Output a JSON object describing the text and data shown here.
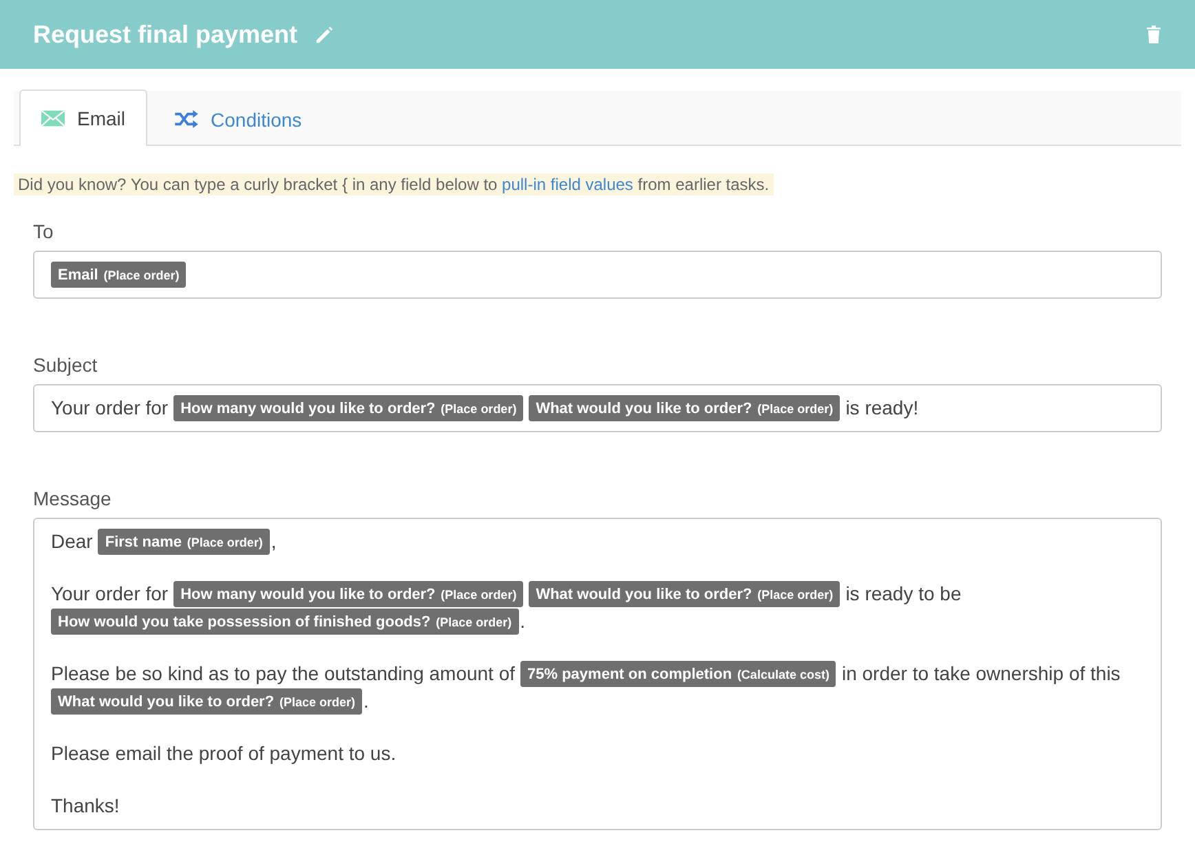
{
  "header": {
    "title": "Request final payment"
  },
  "tabs": [
    {
      "label": "Email",
      "kind": "email",
      "selected": true
    },
    {
      "label": "Conditions",
      "kind": "conditions",
      "selected": false
    }
  ],
  "hint": {
    "before": "Did you know? You can type a curly bracket { in any field below to ",
    "link": "pull-in field values",
    "after": " from earlier tasks."
  },
  "fields": [
    {
      "label": "To",
      "kind": "single",
      "paragraphs": [
        [
          {
            "kind": "token",
            "label": "Email",
            "source": "(Place order)"
          }
        ]
      ]
    },
    {
      "label": "Subject",
      "kind": "single",
      "paragraphs": [
        [
          {
            "kind": "text",
            "text": "Your order for"
          },
          {
            "kind": "token",
            "label": "How many would you like to order?",
            "source": "(Place order)"
          },
          {
            "kind": "token",
            "label": "What would you like to order?",
            "source": "(Place order)"
          },
          {
            "kind": "text",
            "text": "is ready!"
          }
        ]
      ]
    },
    {
      "label": "Message",
      "kind": "multi",
      "paragraphs": [
        [
          {
            "kind": "text",
            "text": "Dear"
          },
          {
            "kind": "token",
            "label": "First name",
            "source": "(Place order)"
          },
          {
            "kind": "text",
            "text": ","
          }
        ],
        [
          {
            "kind": "text",
            "text": "Your order for"
          },
          {
            "kind": "token",
            "label": "How many would you like to order?",
            "source": "(Place order)"
          },
          {
            "kind": "token",
            "label": "What would you like to order?",
            "source": "(Place order)"
          },
          {
            "kind": "text",
            "text": "is ready to be"
          },
          {
            "kind": "break"
          },
          {
            "kind": "token",
            "label": "How would you take possession of finished goods?",
            "source": "(Place order)"
          },
          {
            "kind": "text",
            "text": "."
          }
        ],
        [
          {
            "kind": "text",
            "text": "Please be so kind as to pay the outstanding amount of"
          },
          {
            "kind": "token",
            "label": "75% payment on completion",
            "source": "(Calculate cost)"
          },
          {
            "kind": "text",
            "text": "in order to take ownership of this"
          },
          {
            "kind": "break"
          },
          {
            "kind": "token",
            "label": "What would you like to order?",
            "source": "(Place order)"
          },
          {
            "kind": "text",
            "text": "."
          }
        ],
        [
          {
            "kind": "text",
            "text": "Please email the proof of payment to us."
          }
        ],
        [
          {
            "kind": "text",
            "text": "Thanks!"
          }
        ]
      ]
    }
  ]
}
